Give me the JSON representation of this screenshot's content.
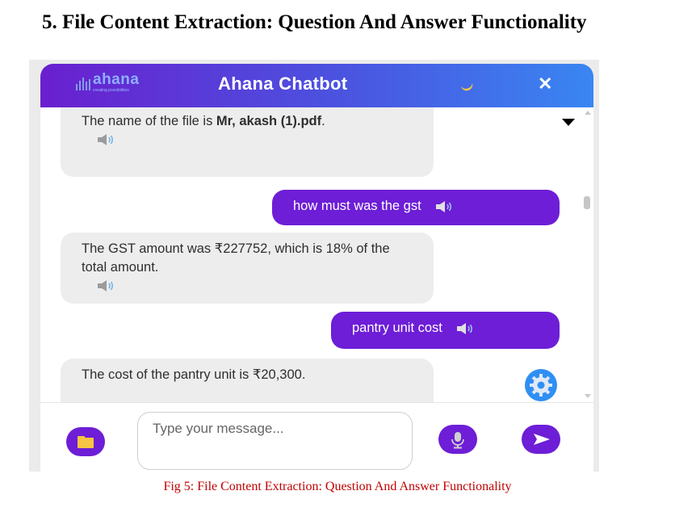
{
  "document": {
    "heading": "5. File Content Extraction: Question And Answer Functionality",
    "caption": "Fig 5: File Content Extraction: Question And Answer Functionality"
  },
  "chatbot": {
    "logo_text": "ahana",
    "logo_subtitle": "creating possibilities",
    "title": "Ahana Chatbot",
    "theme_icon": "moon-icon",
    "close_label": "✕",
    "colors": {
      "header_start": "#6a1fcf",
      "header_end": "#3a86f2",
      "user_bubble": "#6d1ed6",
      "bot_bubble": "#ededed",
      "gear_button": "#2f8ff3"
    }
  },
  "messages": [
    {
      "role": "bot",
      "text_pre": "The name of the file is ",
      "text_bold": "Mr, akash (1).pdf",
      "text_post": "."
    },
    {
      "role": "user",
      "text": "how must was the gst"
    },
    {
      "role": "bot",
      "text": "The GST amount was ₹227752, which is 18% of the total amount."
    },
    {
      "role": "user",
      "text": "pantry unit cost"
    },
    {
      "role": "bot",
      "text": "The cost of the pantry unit is ₹20,300."
    }
  ],
  "composer": {
    "placeholder": "Type your message...",
    "attach_icon": "folder-icon",
    "mic_icon": "microphone-icon",
    "send_icon": "send-icon"
  }
}
